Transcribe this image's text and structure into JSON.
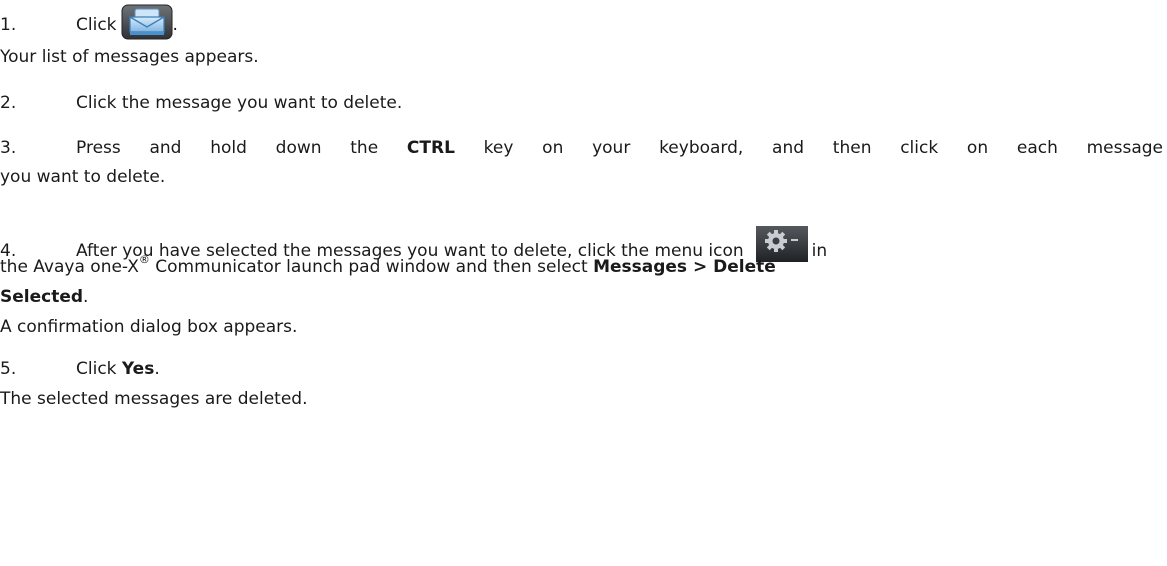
{
  "steps": [
    {
      "number": "1.",
      "text_before": "Click",
      "text_after": ".",
      "icon": "messages-icon"
    },
    {
      "number": "2.",
      "text": "Click the message you want to delete."
    },
    {
      "number": "3.",
      "text_a": "Press and hold down the",
      "bold": "CTRL",
      "text_b": "key on your keyboard, and then click on each message",
      "continuation": "you want to delete."
    },
    {
      "number": "4.",
      "text_a": "After you have selected the messages you want to delete, click the menu icon",
      "text_b": "in",
      "icon": "gear-menu-icon",
      "line2_a": "the Avaya one-X",
      "registered": "®",
      "line2_b": "Communicator launch pad window and then select",
      "bold_a": "Messages > Delete",
      "bold_b": "Selected",
      "end": "."
    },
    {
      "number": "5.",
      "text_before": "Click",
      "bold": "Yes",
      "text_after": "."
    }
  ],
  "results": {
    "step1": "Your list of messages appears.",
    "step4": "A confirmation dialog box appears.",
    "step5": "The selected messages are deleted."
  }
}
